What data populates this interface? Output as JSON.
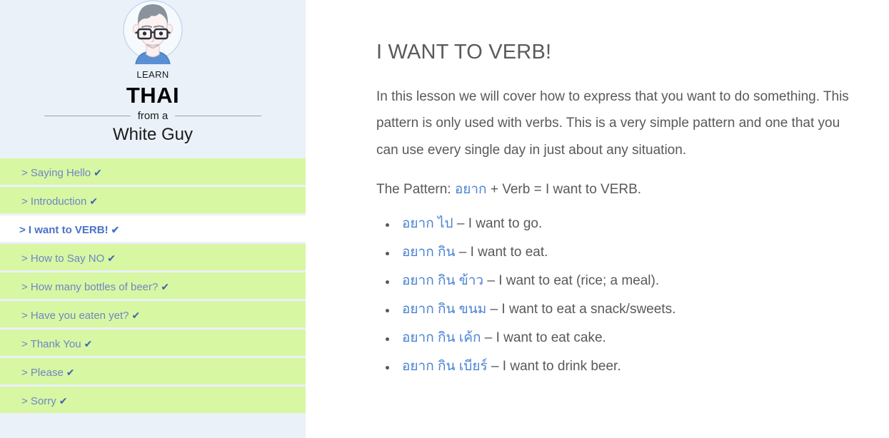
{
  "sidebar": {
    "brand": {
      "learn": "LEARN",
      "language": "THAI",
      "from_a": "from a",
      "author": "White Guy",
      "avatar_icon": "avatar-illustration"
    },
    "nav_items": [
      {
        "label": "> Saying Hello",
        "check": "✔",
        "active": false
      },
      {
        "label": "> Introduction",
        "check": "✔",
        "active": false
      },
      {
        "label": "> I want to VERB!",
        "check": "✔",
        "active": true
      },
      {
        "label": "> How to Say NO",
        "check": "✔",
        "active": false
      },
      {
        "label": "> How many bottles of beer?",
        "check": "✔",
        "active": false
      },
      {
        "label": "> Have you eaten yet?",
        "check": "✔",
        "active": false
      },
      {
        "label": "> Thank You",
        "check": "✔",
        "active": false
      },
      {
        "label": "> Please",
        "check": "✔",
        "active": false
      },
      {
        "label": "> Sorry",
        "check": "✔",
        "active": false
      }
    ]
  },
  "main": {
    "title": "I WANT TO VERB!",
    "intro": "In this lesson we will cover how to express that you want to do something. This pattern is only used with verbs. This is a very simple pattern and one that you can use every single day in just about any situation.",
    "pattern_prefix": "The Pattern: ",
    "pattern_thai": "อยาก",
    "pattern_suffix": " + Verb = I want to VERB.",
    "examples": [
      {
        "thai": "อยาก ไป",
        "translation": " – I want to go."
      },
      {
        "thai": "อยาก กิน",
        "translation": " – I want to eat."
      },
      {
        "thai": "อยาก กิน ข้าว",
        "translation": " – I want to eat (rice; a meal)."
      },
      {
        "thai": "อยาก กิน ขนม",
        "translation": " – I want to eat a snack/sweets."
      },
      {
        "thai": "อยาก กิน เค้ก",
        "translation": " – I want to eat cake."
      },
      {
        "thai": "อยาก กิน เบียร์",
        "translation": " – I want to drink beer."
      }
    ]
  },
  "colors": {
    "sidebar_bg": "#eaf1f9",
    "nav_green": "#d7f7a3",
    "nav_text": "#6f86c4",
    "active_text": "#4a72c8",
    "thai_blue": "#4a83d4",
    "body_text": "#58595b",
    "title_gray": "#5a5a5a"
  }
}
